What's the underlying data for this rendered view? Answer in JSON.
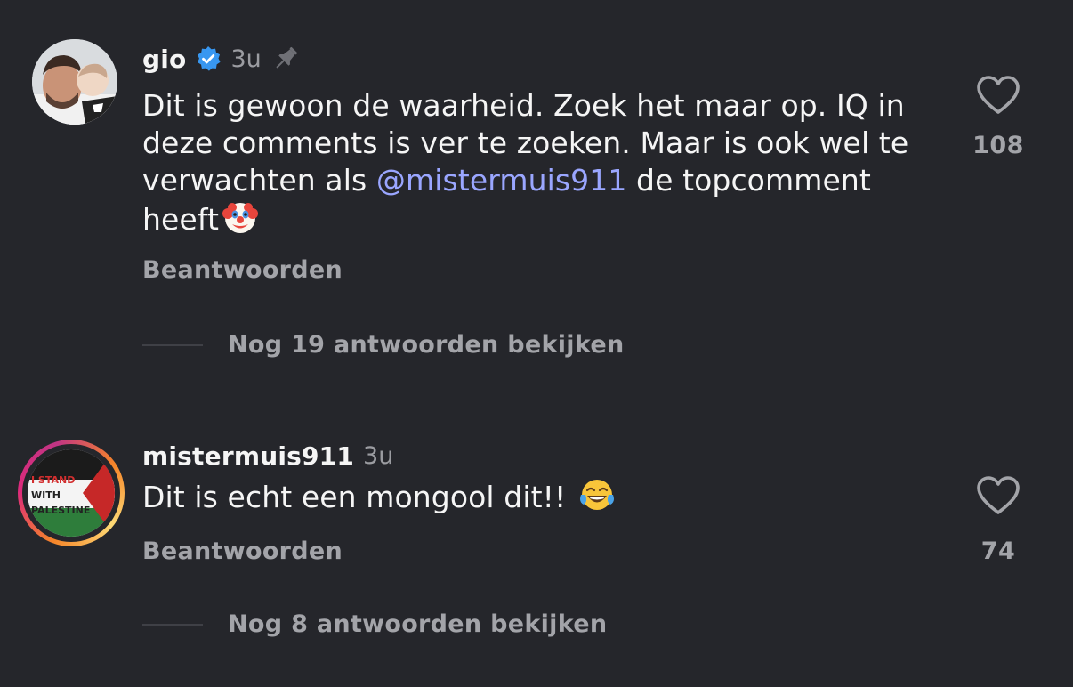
{
  "comments": [
    {
      "username": "gio",
      "verified": true,
      "time": "3u",
      "pinned": true,
      "text_before": "Dit is gewoon de waarheid. Zoek het maar op. IQ in deze comments is ver te zoeken. Maar is ook wel te verwachten als ",
      "mention": "@mistermuis911",
      "text_after": " de topcomment heeft",
      "emoji": "clown-face",
      "reply_label": "Beantwoorden",
      "view_replies_label": "Nog 19 antwoorden bekijken",
      "like_count": "108",
      "avatar_icon": "profile-photo"
    },
    {
      "username": "mistermuis911",
      "verified": false,
      "time": "3u",
      "pinned": false,
      "text": "Dit is echt een mongool dit!! ",
      "emoji": "face-with-tears-of-joy",
      "reply_label": "Beantwoorden",
      "view_replies_label": "Nog 8 antwoorden bekijken",
      "like_count": "74",
      "avatar_text_1": "I STAND",
      "avatar_text_2": "WITH",
      "avatar_text_3": "PALESTINE",
      "avatar_icon": "palestine-flag"
    }
  ],
  "colors": {
    "background": "#25262b",
    "mention": "#9aa6ff",
    "verified": "#3897f0",
    "muted": "#a3a4a9"
  }
}
